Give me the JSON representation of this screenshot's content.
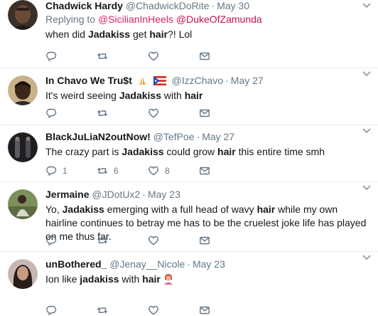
{
  "tweets": [
    {
      "name": "Chadwick Hardy",
      "handle": "@ChadwickDoRite",
      "time": "May 30",
      "reply_prefix": "Replying to",
      "reply_mentions": [
        "@SicilianInHeels",
        "@DukeOfZamunda"
      ],
      "text": [
        {
          "t": "when did "
        },
        {
          "t": "Jadakiss",
          "b": true
        },
        {
          "t": " get "
        },
        {
          "t": "hair",
          "b": true
        },
        {
          "t": "?! Lol"
        }
      ],
      "counts": {
        "reply": "",
        "retweet": "",
        "like": ""
      }
    },
    {
      "name": "In Chavo We Tru$t",
      "name_emoji": [
        "praying-hands-icon",
        "puerto-rico-flag-icon"
      ],
      "handle": "@IzzChavo",
      "time": "May 27",
      "text": [
        {
          "t": "It's weird seeing "
        },
        {
          "t": "Jadakiss",
          "b": true
        },
        {
          "t": " with "
        },
        {
          "t": "hair",
          "b": true
        }
      ],
      "counts": {
        "reply": "",
        "retweet": "",
        "like": ""
      }
    },
    {
      "name": "BlackJuLiaN2outNow!",
      "handle": "@TefPoe",
      "time": "May 27",
      "text": [
        {
          "t": "The crazy part is "
        },
        {
          "t": "Jadakiss",
          "b": true
        },
        {
          "t": " could grow "
        },
        {
          "t": "hair",
          "b": true
        },
        {
          "t": " this entire time smh"
        }
      ],
      "counts": {
        "reply": "1",
        "retweet": "6",
        "like": "8"
      }
    },
    {
      "name": "Jermaine",
      "handle": "@JDotUx2",
      "time": "May 23",
      "text": [
        {
          "t": "Yo, "
        },
        {
          "t": "Jadakiss",
          "b": true
        },
        {
          "t": " emerging with a full head of wavy "
        },
        {
          "t": "hair",
          "b": true
        },
        {
          "t": " while my own hairline continues to betray me has to be the cruelest joke life has played on me thus far."
        }
      ],
      "counts": {
        "reply": "",
        "retweet": "",
        "like": ""
      }
    },
    {
      "name": "unBothered_",
      "handle": "@Jenay__Nicole",
      "time": "May 23",
      "text": [
        {
          "t": "Ion like "
        },
        {
          "t": "jadakiss",
          "b": true
        },
        {
          "t": " with "
        },
        {
          "t": "hair",
          "b": true
        }
      ],
      "text_emoji": "woman-tipping-hand-icon",
      "counts": {
        "reply": "",
        "retweet": "",
        "like": ""
      }
    }
  ],
  "colors": {
    "text": "#14171a",
    "muted": "#657786",
    "mention": "#e0245e",
    "divider": "#e6ecf0"
  }
}
